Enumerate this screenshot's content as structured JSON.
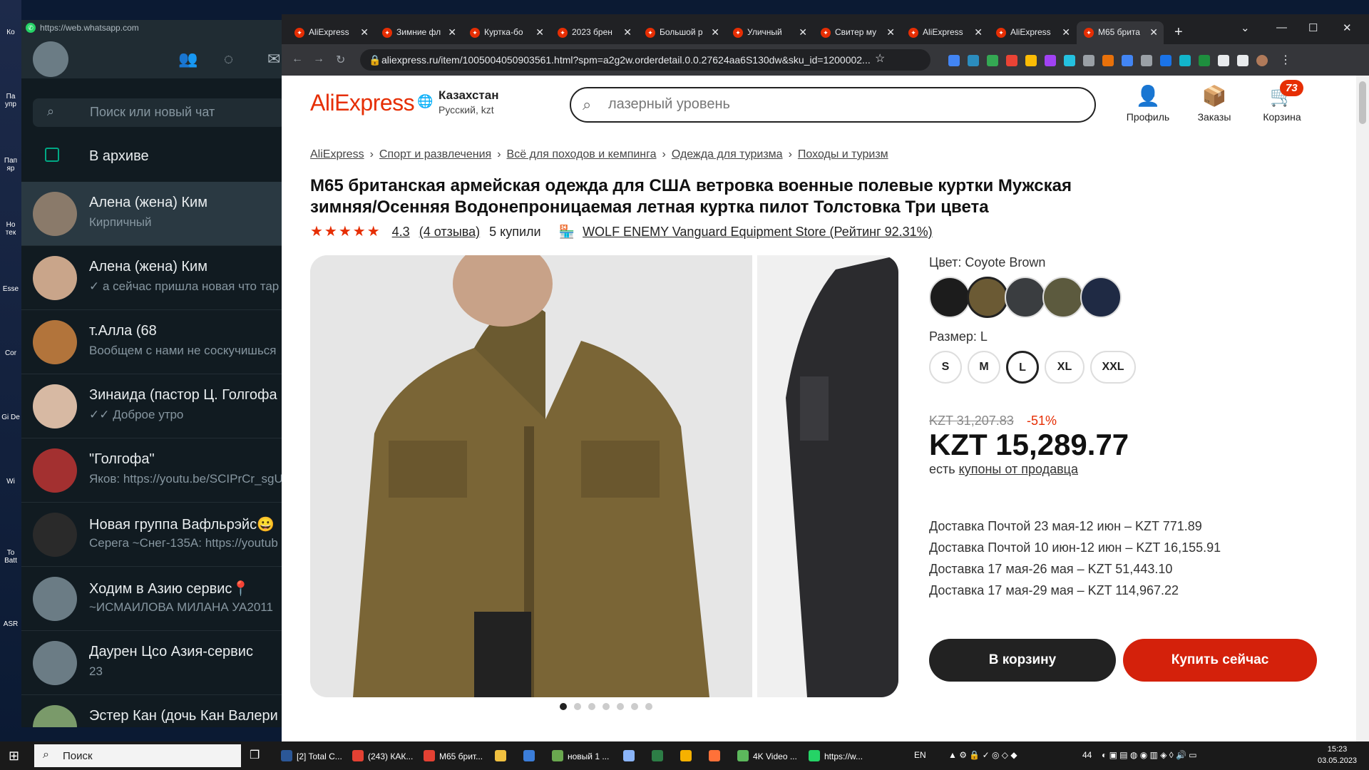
{
  "desktop": {
    "icons": [
      "Ко",
      "Па упр",
      "Пап яр",
      "Но тек",
      "Esse",
      "Cor",
      "Gi De",
      "Wi",
      "To Batt",
      "ASR"
    ]
  },
  "whatsapp": {
    "url": "https://web.whatsapp.com",
    "search_placeholder": "Поиск или новый чат",
    "archive_label": "В архиве",
    "chats": [
      {
        "name": "Алена (жена) Ким",
        "last": "Кирпичный",
        "avatar_color": "#8a7a6a"
      },
      {
        "name": "Алена (жена) Ким",
        "last": "✓ а сейчас пришла новая что тар",
        "avatar_color": "#c9a58a"
      },
      {
        "name": "т.Алла (68",
        "last": "Вообщем с нами не соскучишься",
        "avatar_color": "#b2743b"
      },
      {
        "name": "Зинаида (пастор Ц. Голгофа",
        "last": "✓✓ Доброе утро",
        "avatar_color": "#d7b9a3"
      },
      {
        "name": "\"Голгофа\"",
        "last": "Яков: https://youtu.be/SCIPrCr_sgU",
        "avatar_color": "#a33030"
      },
      {
        "name": "Новая группа Вафльрэйс😀",
        "last": "Серега ~Снег-135А: https://youtub",
        "avatar_color": "#2a2a2a"
      },
      {
        "name": "Ходим в Азию сервис📍",
        "last": "~ИСМАИЛОВА МИЛАНА УА2011",
        "avatar_color": "#6b7c85"
      },
      {
        "name": "Даурен Цсо Азия-сервис",
        "last": "23",
        "avatar_color": "#6b7c85"
      },
      {
        "name": "Эстер Кан (дочь Кан Валери",
        "last": "",
        "avatar_color": "#7a9a6a"
      }
    ]
  },
  "browser": {
    "tabs": [
      {
        "label": "AliExpress"
      },
      {
        "label": "Зимние фл"
      },
      {
        "label": "Куртка-бо"
      },
      {
        "label": "2023 брен"
      },
      {
        "label": "Большой р"
      },
      {
        "label": "Уличный"
      },
      {
        "label": "Свитер му"
      },
      {
        "label": "AliExpress"
      },
      {
        "label": "AliExpress"
      },
      {
        "label": "М65 брита"
      }
    ],
    "url": "aliexpress.ru/item/1005004050903561.html?spm=a2g2w.orderdetail.0.0.27624aa6S130dw&sku_id=1200002..."
  },
  "page": {
    "logo": "AliExpress",
    "region": {
      "country": "Казахстан",
      "lang": "Русский, kzt"
    },
    "search_placeholder": "лазерный уровень",
    "header_buttons": {
      "profile": "Профиль",
      "orders": "Заказы",
      "cart": "Корзина",
      "cart_count": "73"
    },
    "breadcrumb": [
      "AliExpress",
      "Спорт и развлечения",
      "Всё для походов и кемпинга",
      "Одежда для туризма",
      "Походы и туризм"
    ],
    "title": "М65 британская армейская одежда для США ветровка военные полевые куртки Мужская зимняя/Осенняя Водонепроницаемая летная куртка пилот Толстовка Три цвета",
    "rating": "4.3",
    "reviews": "(4 отзыва)",
    "sold": "5 купили",
    "store": "WOLF ENEMY Vanguard Equipment Store (Рейтинг 92.31%)",
    "color_label": "Цвет: Coyote Brown",
    "colors": [
      "#1c1c1c",
      "#6b5a34",
      "#3a3d40",
      "#5c5a3e",
      "#1f2a44"
    ],
    "size_label": "Размер: L",
    "sizes": [
      "S",
      "M",
      "L",
      "XL",
      "XXL"
    ],
    "old_price": "KZT 31,207.83",
    "discount": "-51%",
    "price": "KZT 15,289.77",
    "coupon_prefix": "есть",
    "coupon_link": "купоны от продавца",
    "delivery": [
      "Доставка Почтой 23 мая-12 июн – KZT 771.89",
      "Доставка Почтой 10 июн-12 июн – KZT 16,155.91",
      "Доставка 17 мая-26 мая – KZT 51,443.10",
      "Доставка 17 мая-29 мая – KZT 114,967.22"
    ],
    "cart_button": "В корзину",
    "buy_button": "Купить сейчас",
    "gallery_dots": 7
  },
  "taskbar": {
    "search": "Поиск",
    "apps": [
      {
        "label": "[2] Total C...",
        "color": "#2b5797"
      },
      {
        "label": "(243) КАК...",
        "color": "#e34133"
      },
      {
        "label": "М65 брит...",
        "color": "#e34133"
      },
      {
        "label": "",
        "color": "#f0c040"
      },
      {
        "label": "",
        "color": "#3b7dd8"
      },
      {
        "label": "новый 1 ...",
        "color": "#6aa84f"
      },
      {
        "label": "",
        "color": "#8ab4f8"
      },
      {
        "label": "",
        "color": "#2d7d46"
      },
      {
        "label": "",
        "color": "#f6b100"
      },
      {
        "label": "",
        "color": "#ff7139"
      },
      {
        "label": "4K Video ...",
        "color": "#5cb85c"
      },
      {
        "label": "https://w...",
        "color": "#25d366"
      }
    ],
    "lang": "EN",
    "tray_num": "44",
    "time": "15:23",
    "date": "03.05.2023"
  }
}
